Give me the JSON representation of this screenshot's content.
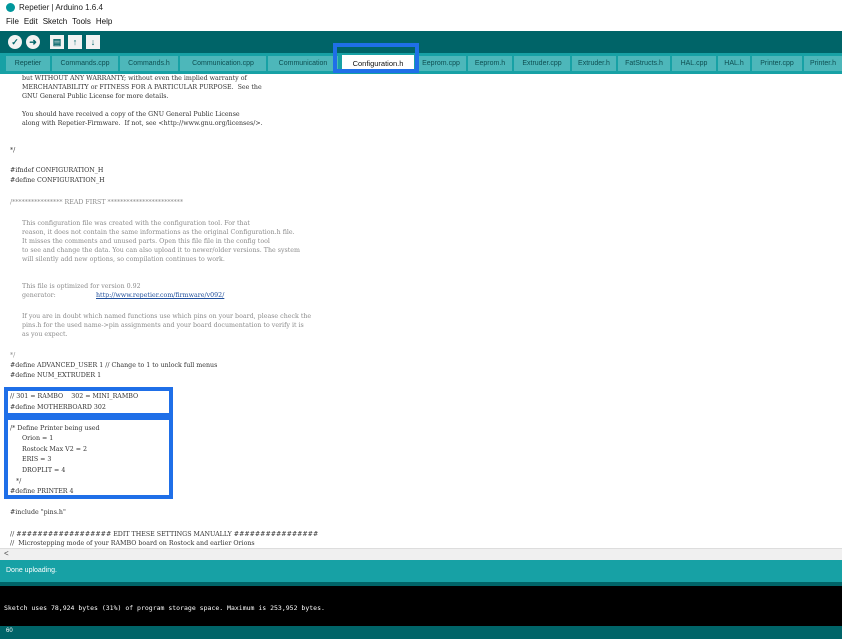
{
  "window": {
    "title": "Repetier | Arduino 1.6.4"
  },
  "menu": {
    "items": [
      "File",
      "Edit",
      "Sketch",
      "Tools",
      "Help"
    ]
  },
  "toolbar": {
    "verify_icon": "check-icon",
    "upload_icon": "arrow-right-icon",
    "new_icon": "new-file-icon",
    "open_icon": "open-icon",
    "save_icon": "save-icon"
  },
  "tabs": [
    "Repetier",
    "Commands.cpp",
    "Commands.h",
    "Communication.cpp",
    "Communication",
    "Configuration.h",
    "Eeprom.cpp",
    "Eeprom.h",
    "Extruder.cpp",
    "Extruder.h",
    "FatStructs.h",
    "HAL.cpp",
    "HAL.h",
    "Printer.cpp",
    "Printer.h"
  ],
  "active_tab": "Configuration.h",
  "code": [
    "but WITHOUT ANY WARRANTY; without even the implied warranty of",
    "MERCHANTABILITY or FITNESS FOR A PARTICULAR PURPOSE.  See the",
    "GNU General Public License for more details.",
    "You should have received a copy of the GNU General Public License",
    "along with Repetier-Firmware.  If not, see <http://www.gnu.org/licenses/>.",
    "*/",
    "#ifndef CONFIGURATION_H",
    "#define CONFIGURATION_H",
    "/**************** READ FIRST ************************",
    "This configuration file was created with the configuration tool. For that",
    "reason, it does not contain the same informations as the original Configuration.h file.",
    "It misses the comments and unused parts. Open this file file in the config tool",
    "to see and change the data. You can also upload it to newer/older versions. The system",
    "will silently add new options, so compilation continues to work.",
    "This file is optimized for version 0.92",
    "generator: ",
    "http://www.repetier.com/firmware/v092/",
    "If you are in doubt which named functions use which pins on your board, please check the",
    "pins.h for the used name->pin assignments and your board documentation to verify it is",
    "as you expect.",
    "*/",
    "#define ADVANCED_USER 1 // Change to 1 to unlock full menus",
    "#define NUM_EXTRUDER 1",
    "// 301 = RAMBO    302 = MINI_RAMBO",
    "#define MOTHERBOARD 302",
    "/* Define Printer being used",
    "Orion = 1",
    "Rostock Max V2 = 2",
    "ERIS = 3",
    "DROPLIT = 4",
    "*/",
    "#define PRINTER 4",
    "#include \"pins.h\"",
    "// ################## EDIT THESE SETTINGS MANUALLY ################",
    "//  Microstepping mode of your RAMBO board on Rostock and earlier Orions"
  ],
  "scroll_arrow": "<",
  "status": "Done uploading.",
  "console": "Sketch uses 78,924 bytes (31%) of program storage space. Maximum is 253,952 bytes.",
  "line_number": "60",
  "colors": {
    "toolbar": "#006468",
    "tabbar": "#17a1a5",
    "tab": "#4db7ba",
    "highlight": "#1f6fe8",
    "console_bg": "#000000"
  }
}
